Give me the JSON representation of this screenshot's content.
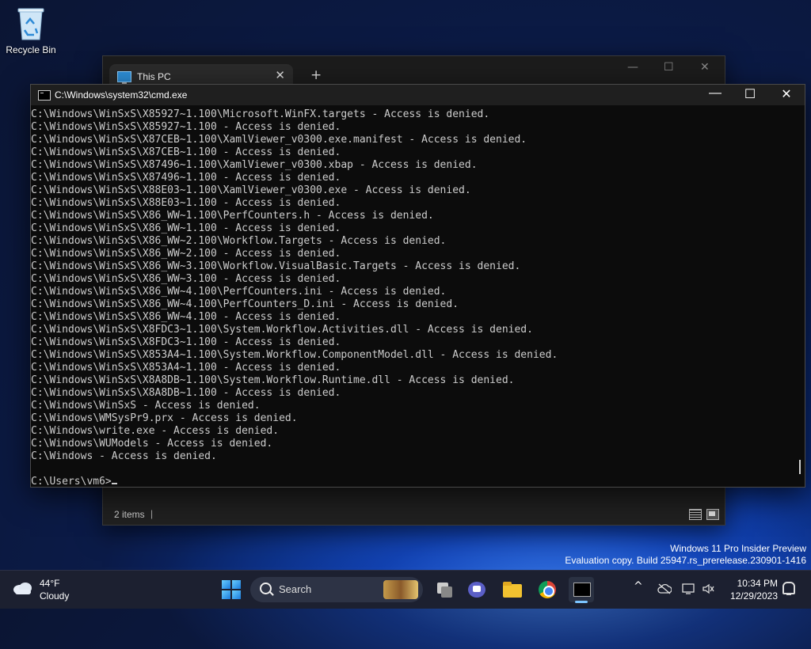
{
  "desktop": {
    "recycle_bin_label": "Recycle Bin"
  },
  "explorer": {
    "tab_title": "This PC",
    "tab_close": "✕",
    "new_tab": "+",
    "minimize": "—",
    "maximize": "☐",
    "close": "✕",
    "status_text": "2 items",
    "status_sep": "|"
  },
  "cmd": {
    "title": "C:\\Windows\\system32\\cmd.exe",
    "minimize": "—",
    "maximize": "☐",
    "close": "✕",
    "lines": [
      "C:\\Windows\\WinSxS\\X85927~1.100\\Microsoft.WinFX.targets - Access is denied.",
      "C:\\Windows\\WinSxS\\X85927~1.100 - Access is denied.",
      "C:\\Windows\\WinSxS\\X87CEB~1.100\\XamlViewer_v0300.exe.manifest - Access is denied.",
      "C:\\Windows\\WinSxS\\X87CEB~1.100 - Access is denied.",
      "C:\\Windows\\WinSxS\\X87496~1.100\\XamlViewer_v0300.xbap - Access is denied.",
      "C:\\Windows\\WinSxS\\X87496~1.100 - Access is denied.",
      "C:\\Windows\\WinSxS\\X88E03~1.100\\XamlViewer_v0300.exe - Access is denied.",
      "C:\\Windows\\WinSxS\\X88E03~1.100 - Access is denied.",
      "C:\\Windows\\WinSxS\\X86_WW~1.100\\PerfCounters.h - Access is denied.",
      "C:\\Windows\\WinSxS\\X86_WW~1.100 - Access is denied.",
      "C:\\Windows\\WinSxS\\X86_WW~2.100\\Workflow.Targets - Access is denied.",
      "C:\\Windows\\WinSxS\\X86_WW~2.100 - Access is denied.",
      "C:\\Windows\\WinSxS\\X86_WW~3.100\\Workflow.VisualBasic.Targets - Access is denied.",
      "C:\\Windows\\WinSxS\\X86_WW~3.100 - Access is denied.",
      "C:\\Windows\\WinSxS\\X86_WW~4.100\\PerfCounters.ini - Access is denied.",
      "C:\\Windows\\WinSxS\\X86_WW~4.100\\PerfCounters_D.ini - Access is denied.",
      "C:\\Windows\\WinSxS\\X86_WW~4.100 - Access is denied.",
      "C:\\Windows\\WinSxS\\X8FDC3~1.100\\System.Workflow.Activities.dll - Access is denied.",
      "C:\\Windows\\WinSxS\\X8FDC3~1.100 - Access is denied.",
      "C:\\Windows\\WinSxS\\X853A4~1.100\\System.Workflow.ComponentModel.dll - Access is denied.",
      "C:\\Windows\\WinSxS\\X853A4~1.100 - Access is denied.",
      "C:\\Windows\\WinSxS\\X8A8DB~1.100\\System.Workflow.Runtime.dll - Access is denied.",
      "C:\\Windows\\WinSxS\\X8A8DB~1.100 - Access is denied.",
      "C:\\Windows\\WinSxS - Access is denied.",
      "C:\\Windows\\WMSysPr9.prx - Access is denied.",
      "C:\\Windows\\write.exe - Access is denied.",
      "C:\\Windows\\WUModels - Access is denied.",
      "C:\\Windows - Access is denied."
    ],
    "prompt": "C:\\Users\\vm6>"
  },
  "watermark": {
    "line1": "Windows 11 Pro Insider Preview",
    "line2": "Evaluation copy. Build 25947.rs_prerelease.230901-1416"
  },
  "taskbar": {
    "weather_temp": "44°F",
    "weather_condition": "Cloudy",
    "search_label": "Search",
    "tray_chevron": "^",
    "clock_time": "10:34 PM",
    "clock_date": "12/29/2023"
  }
}
